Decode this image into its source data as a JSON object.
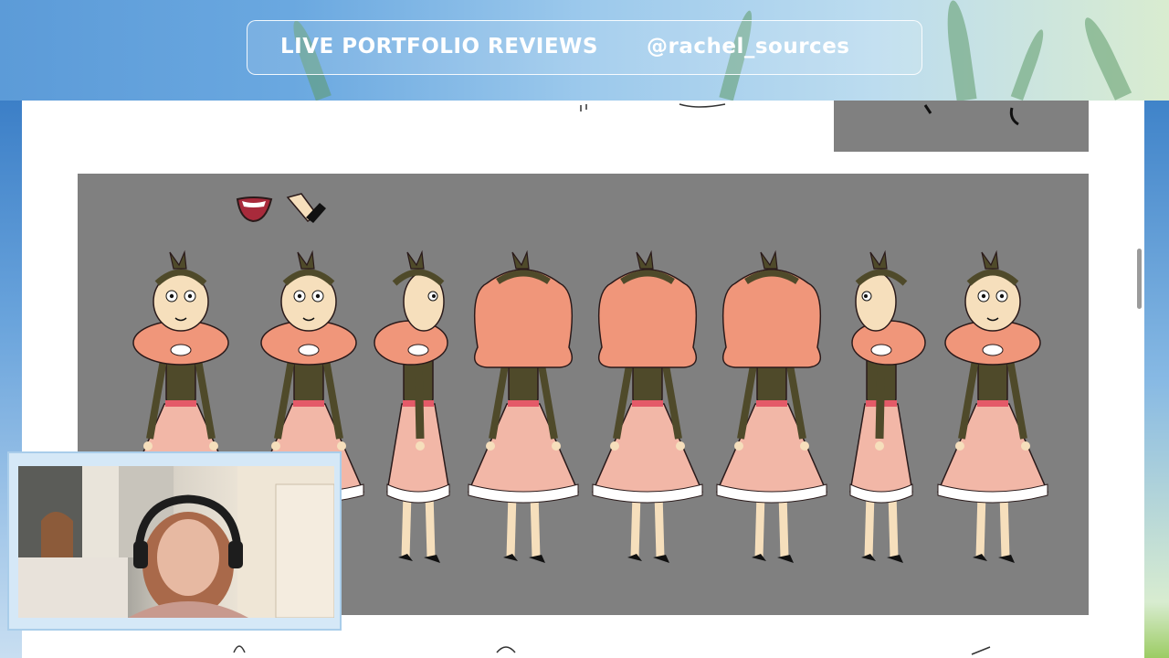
{
  "banner": {
    "title": "LIVE PORTFOLIO REVIEWS",
    "handle": "@rachel_sources"
  },
  "artwork": {
    "subject": "character-turnaround",
    "view_count": 8
  },
  "colors": {
    "hair": "#f0967a",
    "shirt": "#4f4a2a",
    "skirt": "#f2b7a7",
    "skin": "#f6dfbc",
    "belt": "#e45a68",
    "sheet_bg": "#808080",
    "banner_text": "#ffffff"
  }
}
